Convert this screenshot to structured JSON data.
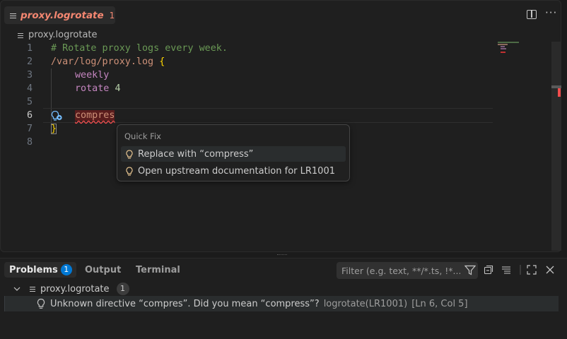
{
  "editor": {
    "tab": {
      "title": "proxy.logrotate",
      "problem_count": "1"
    },
    "breadcrumb": "proxy.logrotate",
    "lines": [
      {
        "n": "1",
        "text": "# Rotate proxy logs every week."
      },
      {
        "n": "2",
        "text": "/var/log/proxy.log {"
      },
      {
        "n": "3",
        "text": "    weekly"
      },
      {
        "n": "4",
        "text": "    rotate 4"
      },
      {
        "n": "5",
        "text": ""
      },
      {
        "n": "6",
        "text": "    compres"
      },
      {
        "n": "7",
        "text": "}"
      },
      {
        "n": "8",
        "text": ""
      }
    ],
    "tokens": {
      "l1_comment": "# Rotate proxy logs every week.",
      "l2_path": "/var/log/proxy.log ",
      "l2_brace": "{",
      "l3_key": "weekly",
      "l4_key": "rotate",
      "l4_num": "4",
      "l6_err": "compres",
      "l7_brace": "}"
    }
  },
  "quick_fix": {
    "title": "Quick Fix",
    "items": [
      "Replace with “compress”",
      "Open upstream documentation for LR1001"
    ]
  },
  "panel": {
    "tabs": [
      {
        "label": "Problems",
        "badge": "1"
      },
      {
        "label": "Output"
      },
      {
        "label": "Terminal"
      }
    ],
    "filter_placeholder": "Filter (e.g. text, **/*.ts, !*...",
    "tree": {
      "file": "proxy.logrotate",
      "count": "1",
      "problem": {
        "message": "Unknown directive “compres”. Did you mean “compress”?",
        "source": "logrotate(LR1001)",
        "location": "[Ln 6, Col 5]"
      }
    }
  },
  "colors": {
    "error": "#f48771",
    "accent": "#0078d4",
    "warning_bulb": "#e2c08d"
  }
}
